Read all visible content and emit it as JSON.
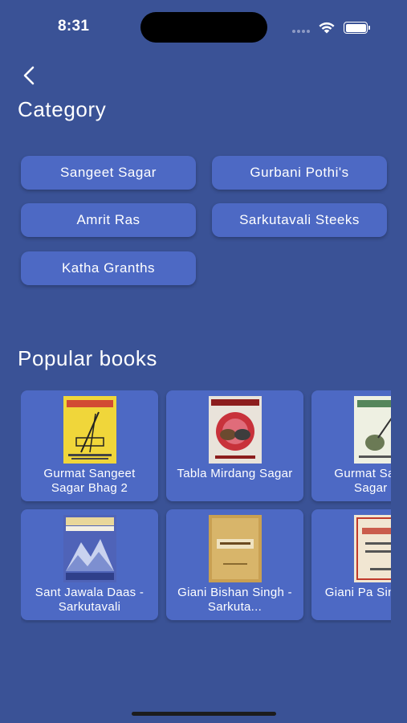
{
  "status_bar": {
    "time": "8:31"
  },
  "category": {
    "title": "Category",
    "items": [
      {
        "label": "Sangeet Sagar"
      },
      {
        "label": "Gurbani Pothi's"
      },
      {
        "label": "Amrit Ras"
      },
      {
        "label": "Sarkutavali Steeks"
      },
      {
        "label": "Katha Granths"
      }
    ]
  },
  "popular_books": {
    "title": "Popular books",
    "books": [
      {
        "title": "Gurmat Sangeet Sagar Bhag 2",
        "cover": "yellow-cover"
      },
      {
        "title": "Tabla Mirdang Sagar",
        "cover": "red-drum-cover"
      },
      {
        "title": "Gurmat Sangeet Sagar Bh",
        "cover": "white-veena-cover"
      },
      {
        "title": "Sant Jawala Daas - Sarkutavali",
        "cover": "blue-mountain-cover"
      },
      {
        "title": "Giani Bishan Singh - Sarkuta...",
        "cover": "tan-manuscript-cover"
      },
      {
        "title": "Giani Pa Singh - Sa",
        "cover": "cream-bordered-cover"
      }
    ]
  },
  "colors": {
    "background": "#3a5296",
    "card": "#4d69c4",
    "text": "#ffffff"
  }
}
